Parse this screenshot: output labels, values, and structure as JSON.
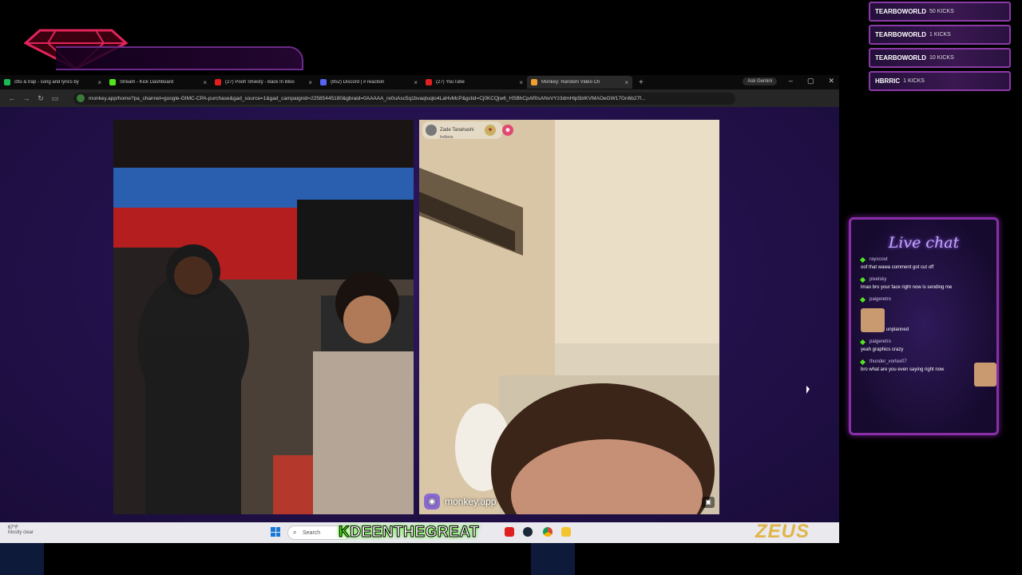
{
  "alerts": [
    {
      "user": "TEARBOWORLD",
      "amount": "50 KICKS"
    },
    {
      "user": "TEARBOWORLD",
      "amount": "1 KICKS"
    },
    {
      "user": "TEARBOWORLD",
      "amount": "10 KICKS"
    },
    {
      "user": "HBRRIC",
      "amount": "1 KICKS"
    }
  ],
  "browser": {
    "tabs": [
      {
        "title": "ctfu & trap - song and lyrics by",
        "fav_color": "#1db954"
      },
      {
        "title": "Stream - Kick Dashboard",
        "fav_color": "#52e51d"
      },
      {
        "title": "(27) Pooh Shiesty - Back In Bloo",
        "fav_color": "#e02020"
      },
      {
        "title": "(852) Discord | # reaction",
        "fav_color": "#5865f2"
      },
      {
        "title": "(27) YouTube",
        "fav_color": "#e02020"
      },
      {
        "title": "Monkey: Random Video Ch",
        "fav_color": "#f0a030"
      }
    ],
    "new_tab": "+",
    "gemini": "Ask Gemini",
    "window_controls": {
      "minimize": "–",
      "maximize": "▢",
      "close": "✕"
    },
    "url": "monkey.app/home?pa_channel=google-GIMC-CPA-purchase&gad_source=1&gad_campaignid=22585445180&gbraid=0AAAAA_re0uAsc5q1bvaqIuqlo4LaHvMcP&gclid=Cj0KCQjw6_HSBhCpARIsANvVYz3dmHlp5bIKVMAOeGW17Gn6b27f..."
  },
  "remote_user": {
    "name": "Zade Tanahashi",
    "location": "Indiana"
  },
  "app_brand": "monkey.app",
  "taskbar": {
    "weather_temp": "67°F",
    "weather_cond": "Mostly clear",
    "search": "Search",
    "streamer_prefix": "K",
    "streamer_name": "DEENTHEGREAT",
    "sponsor": "ZEUS"
  },
  "chat": {
    "title": "Live chat",
    "messages": [
      {
        "user": "rayscout",
        "text": "oof that wawa comment got cut off"
      },
      {
        "user": "pixelsky",
        "text": "lmao bro your face right now is sending me"
      },
      {
        "user": "paigeretro",
        "text": "unplanned"
      },
      {
        "user": "paigeretro",
        "text": "yeah graphics crazy"
      },
      {
        "user": "thunder_vortex07",
        "text": "bro what are you even saying right now"
      }
    ]
  }
}
